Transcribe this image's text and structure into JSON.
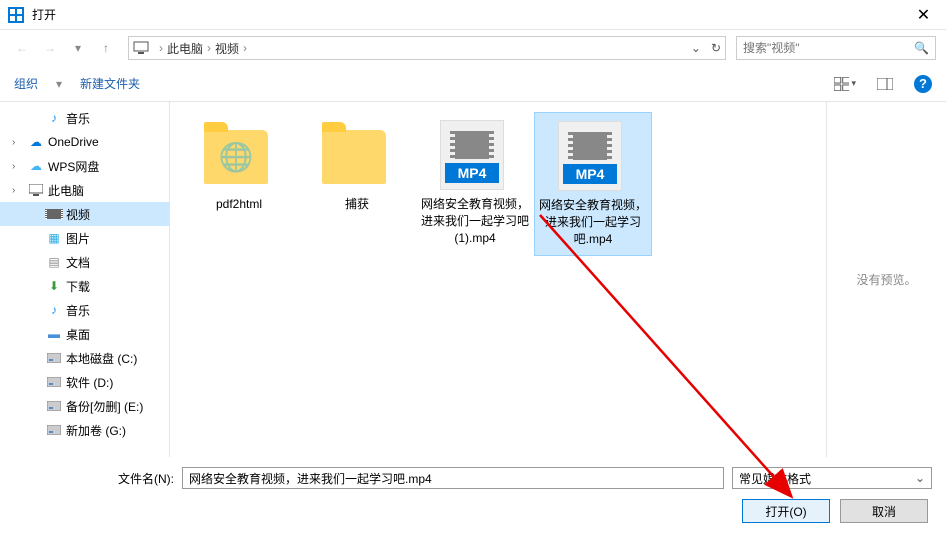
{
  "title": "打开",
  "breadcrumb": {
    "root": "此电脑",
    "folder": "视频"
  },
  "search": {
    "placeholder": "搜索\"视频\""
  },
  "toolbar": {
    "organize": "组织",
    "newfolder": "新建文件夹"
  },
  "sidebar": {
    "items": [
      {
        "label": "音乐",
        "icon": "music",
        "indent": 1
      },
      {
        "label": "OneDrive",
        "icon": "cloud",
        "indent": 0
      },
      {
        "label": "WPS网盘",
        "icon": "wps",
        "indent": 0
      },
      {
        "label": "此电脑",
        "icon": "pc",
        "indent": 0
      },
      {
        "label": "视频",
        "icon": "vid",
        "indent": 1,
        "selected": true
      },
      {
        "label": "图片",
        "icon": "img",
        "indent": 1
      },
      {
        "label": "文档",
        "icon": "doc",
        "indent": 1
      },
      {
        "label": "下载",
        "icon": "dl",
        "indent": 1
      },
      {
        "label": "音乐",
        "icon": "music",
        "indent": 1
      },
      {
        "label": "桌面",
        "icon": "desk",
        "indent": 1
      },
      {
        "label": "本地磁盘 (C:)",
        "icon": "disk",
        "indent": 1
      },
      {
        "label": "软件 (D:)",
        "icon": "disk",
        "indent": 1
      },
      {
        "label": "备份[勿删] (E:)",
        "icon": "disk",
        "indent": 1
      },
      {
        "label": "新加卷 (G:)",
        "icon": "disk",
        "indent": 1
      }
    ]
  },
  "files": {
    "items": [
      {
        "label": "pdf2html",
        "type": "folder-globe"
      },
      {
        "label": "捕获",
        "type": "folder"
      },
      {
        "label": "网络安全教育视频，进来我们一起学习吧 (1).mp4",
        "type": "mp4"
      },
      {
        "label": "网络安全教育视频，进来我们一起学习吧.mp4",
        "type": "mp4",
        "selected": true
      }
    ]
  },
  "preview": {
    "text": "没有预览。"
  },
  "footer": {
    "filename_label": "文件名(N):",
    "filename_value": "网络安全教育视频，进来我们一起学习吧.mp4",
    "filter": "常见媒体格式",
    "open": "打开(O)",
    "cancel": "取消"
  },
  "mp4_tag": "MP4"
}
